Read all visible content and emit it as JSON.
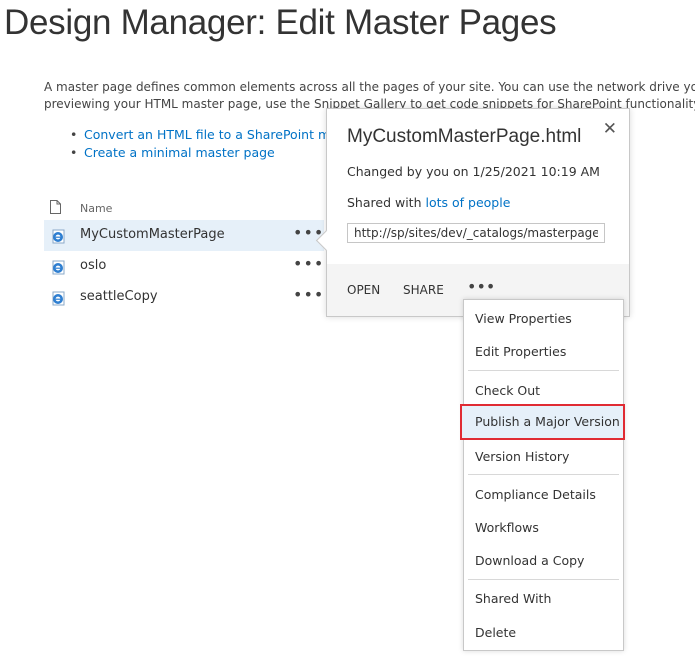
{
  "page": {
    "title": "Design Manager: Edit Master Pages",
    "description_line1": "A master page defines common elements across all the pages of your site. You can use the network drive you map",
    "description_line2": "previewing your HTML master page, use the Snippet Gallery to get code snippets for SharePoint functionality that"
  },
  "links": [
    {
      "label": "Convert an HTML file to a SharePoint mast"
    },
    {
      "label": "Create a minimal master page"
    }
  ],
  "list": {
    "column_name": "Name",
    "files": [
      {
        "name": "MyCustomMasterPage",
        "selected": true
      },
      {
        "name": "oslo",
        "selected": false
      },
      {
        "name": "seattleCopy",
        "selected": false
      }
    ],
    "ellipsis": "•••"
  },
  "callout": {
    "title": "MyCustomMasterPage.html",
    "changed": "Changed by you on 1/25/2021 10:19 AM",
    "shared_prefix": "Shared with ",
    "shared_link": "lots of people",
    "url": "http://sp/sites/dev/_catalogs/masterpage/M",
    "close_glyph": "✕",
    "actions": {
      "open": "OPEN",
      "share": "SHARE",
      "more": "•••"
    }
  },
  "menu": {
    "items": [
      "View Properties",
      "Edit Properties",
      "Check Out",
      "Publish a Major Version",
      "Version History",
      "Compliance Details",
      "Workflows",
      "Download a Copy",
      "Shared With",
      "Delete"
    ],
    "highlighted": "Publish a Major Version",
    "highlight_border_color": "#e02b33"
  },
  "colors": {
    "link": "#0072c6",
    "selected_row": "#e6f0f9"
  }
}
